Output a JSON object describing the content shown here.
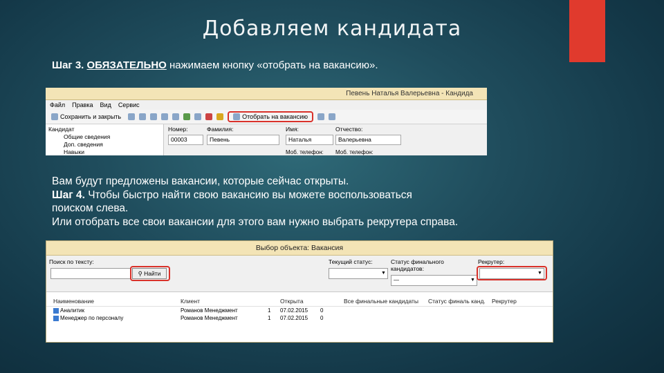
{
  "slide": {
    "title": "Добавляем кандидата",
    "step3_prefix": "Шаг 3.",
    "step3_required": "ОБЯЗАТЕЛЬНО",
    "step3_text": " нажимаем кнопку «отобрать на вакансию».",
    "body_line1": "Вам будут предложены вакансии, которые сейчас открыты.",
    "step4_prefix": "Шаг 4.",
    "body_line2": " Чтобы быстро найти свою вакансию вы можете воспользоваться",
    "body_line3": "поиском слева.",
    "body_line4": "Или отобрать все свои вакансии для этого вам нужно выбрать рекрутера справа.",
    "accent_color": "#e03a2d"
  },
  "shot1": {
    "window_title": "Певень Наталья Валерьевна - Кандида",
    "menu": [
      "Файл",
      "Правка",
      "Вид",
      "Сервис"
    ],
    "toolbar": {
      "save_close": "Сохранить и закрыть",
      "select_vacancy": "Отобрать на вакансию"
    },
    "tree": [
      "Кандидат",
      "Общие сведения",
      "Доп. сведения",
      "Навыки"
    ],
    "fields": {
      "number_label": "Номер:",
      "number_value": "00003",
      "surname_label": "Фамилия:",
      "surname_value": "Певень",
      "name_label": "Имя:",
      "name_value": "Наталья",
      "patronymic_label": "Отчество:",
      "patronymic_value": "Валерьевна",
      "row2_left": "Моб. телефон:",
      "row2_right": "Моб. телефон:"
    }
  },
  "shot2": {
    "window_title": "Выбор объекта: Вакансия",
    "search_label": "Поиск по тексту:",
    "find_button": "Найти",
    "status_label": "Текущий статус:",
    "final_status_label": "Статус финального кандидатов:",
    "final_status_value": "—",
    "recruiter_label": "Рекрутер:",
    "columns": [
      "Наименование",
      "Клиент",
      "",
      "Открыта",
      "",
      "",
      "Все финальные кандидаты",
      "Статус финаль канд.",
      "Рекрутер"
    ],
    "rows": [
      {
        "name": "Аналитик",
        "client": "Романов Менеджмент",
        "count": "1",
        "opened": "07.02.2015",
        "n": "0"
      },
      {
        "name": "Менеджер по персоналу",
        "client": "Романов Менеджмент",
        "count": "1",
        "opened": "07.02.2015",
        "n": "0"
      }
    ]
  }
}
